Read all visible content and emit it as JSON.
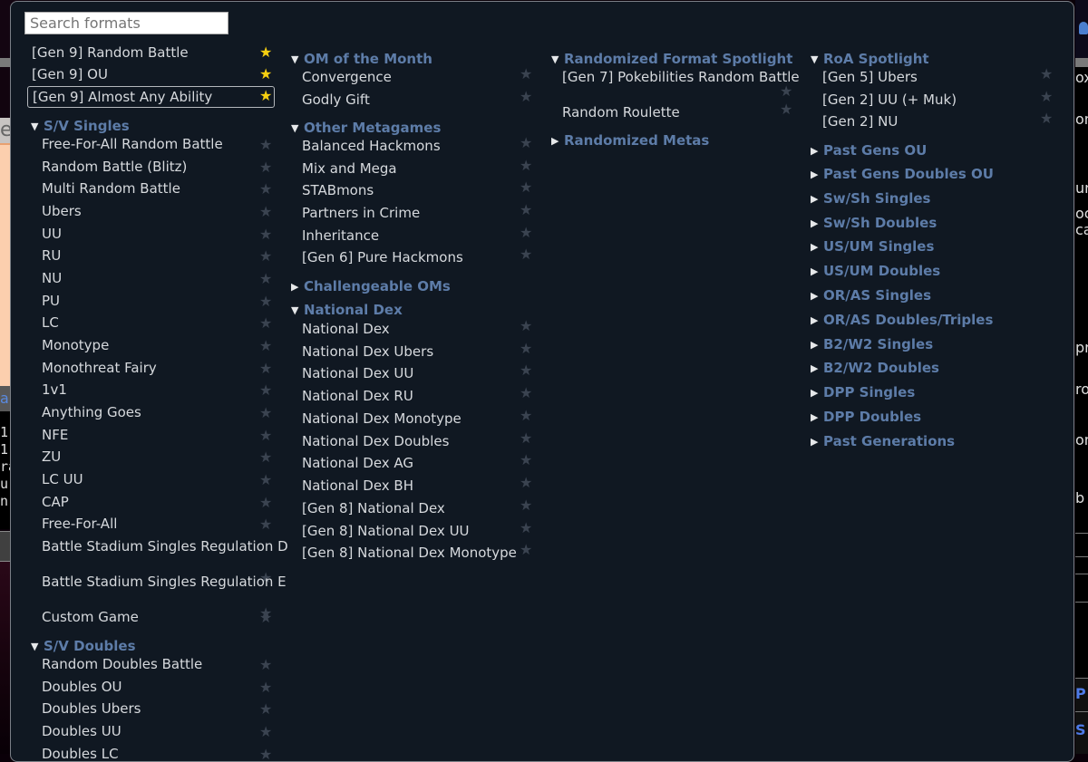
{
  "search": {
    "placeholder": "Search formats",
    "value": ""
  },
  "favorites": [
    {
      "label": "[Gen 9] Random Battle",
      "starred": true,
      "selected": false
    },
    {
      "label": "[Gen 9] OU",
      "starred": true,
      "selected": false
    },
    {
      "label": "[Gen 9] Almost Any Ability",
      "starred": true,
      "selected": true
    }
  ],
  "columns": [
    {
      "groups": [
        {
          "title": "S/V Singles",
          "expanded": true,
          "items": [
            "Free-For-All Random Battle",
            "Random Battle (Blitz)",
            "Multi Random Battle",
            "Ubers",
            "UU",
            "RU",
            "NU",
            "PU",
            "LC",
            "Monotype",
            "Monothreat Fairy",
            "1v1",
            "Anything Goes",
            "NFE",
            "ZU",
            "LC UU",
            "CAP",
            "Free-For-All",
            "Battle Stadium Singles Regulation D",
            "Battle Stadium Singles Regulation E",
            "Custom Game"
          ]
        },
        {
          "title": "S/V Doubles",
          "expanded": true,
          "items": [
            "Random Doubles Battle",
            "Doubles OU",
            "Doubles Ubers",
            "Doubles UU",
            "Doubles LC"
          ]
        }
      ]
    },
    {
      "groups": [
        {
          "title": "OM of the Month",
          "expanded": true,
          "items": [
            "Convergence",
            "Godly Gift"
          ]
        },
        {
          "title": "Other Metagames",
          "expanded": true,
          "items": [
            "Balanced Hackmons",
            "Mix and Mega",
            "STABmons",
            "Partners in Crime",
            "Inheritance",
            "[Gen 6] Pure Hackmons"
          ]
        },
        {
          "title": "Challengeable OMs",
          "expanded": false,
          "items": []
        },
        {
          "title": "National Dex",
          "expanded": true,
          "items": [
            "National Dex",
            "National Dex Ubers",
            "National Dex UU",
            "National Dex RU",
            "National Dex Monotype",
            "National Dex Doubles",
            "National Dex AG",
            "National Dex BH",
            "[Gen 8] National Dex",
            "[Gen 8] National Dex UU",
            "[Gen 8] National Dex Monotype"
          ]
        }
      ]
    },
    {
      "groups": [
        {
          "title": "Randomized Format Spotlight",
          "expanded": true,
          "items": [
            "[Gen 7] Pokebilities Random Battle",
            "Random Roulette"
          ]
        },
        {
          "title": "Randomized Metas",
          "expanded": false,
          "items": []
        }
      ]
    },
    {
      "groups": [
        {
          "title": "RoA Spotlight",
          "expanded": true,
          "items": [
            "[Gen 5] Ubers",
            "[Gen 2] UU (+ Muk)",
            "[Gen 2] NU"
          ]
        },
        {
          "title": "Past Gens OU",
          "expanded": false,
          "items": []
        },
        {
          "title": "Past Gens Doubles OU",
          "expanded": false,
          "items": []
        },
        {
          "title": "Sw/Sh Singles",
          "expanded": false,
          "items": []
        },
        {
          "title": "Sw/Sh Doubles",
          "expanded": false,
          "items": []
        },
        {
          "title": "US/UM Singles",
          "expanded": false,
          "items": []
        },
        {
          "title": "US/UM Doubles",
          "expanded": false,
          "items": []
        },
        {
          "title": "OR/AS Singles",
          "expanded": false,
          "items": []
        },
        {
          "title": "OR/AS Doubles/Triples",
          "expanded": false,
          "items": []
        },
        {
          "title": "B2/W2 Singles",
          "expanded": false,
          "items": []
        },
        {
          "title": "B2/W2 Doubles",
          "expanded": false,
          "items": []
        },
        {
          "title": "DPP Singles",
          "expanded": false,
          "items": []
        },
        {
          "title": "DPP Doubles",
          "expanded": false,
          "items": []
        },
        {
          "title": "Past Generations",
          "expanded": false,
          "items": []
        }
      ]
    }
  ],
  "icons": {
    "star": "★",
    "expanded": "▼",
    "collapsed": "▶"
  },
  "background": {
    "left_tab_text": "e",
    "left_link_text": "al",
    "left_chat_lines": [
      "1:",
      "1:",
      "ra",
      "u",
      "n"
    ],
    "right_texts": [
      "ox",
      "om",
      "ur",
      "oc",
      "ca",
      "pr",
      "ro",
      "om",
      "b"
    ],
    "right_link_texts": [
      "P",
      "S"
    ]
  },
  "colors": {
    "popup_bg": "#101822",
    "group_title": "#5d7ca8",
    "star_on": "#f6cf10",
    "star_off": "#3a4350",
    "text": "#d6d9dd"
  }
}
